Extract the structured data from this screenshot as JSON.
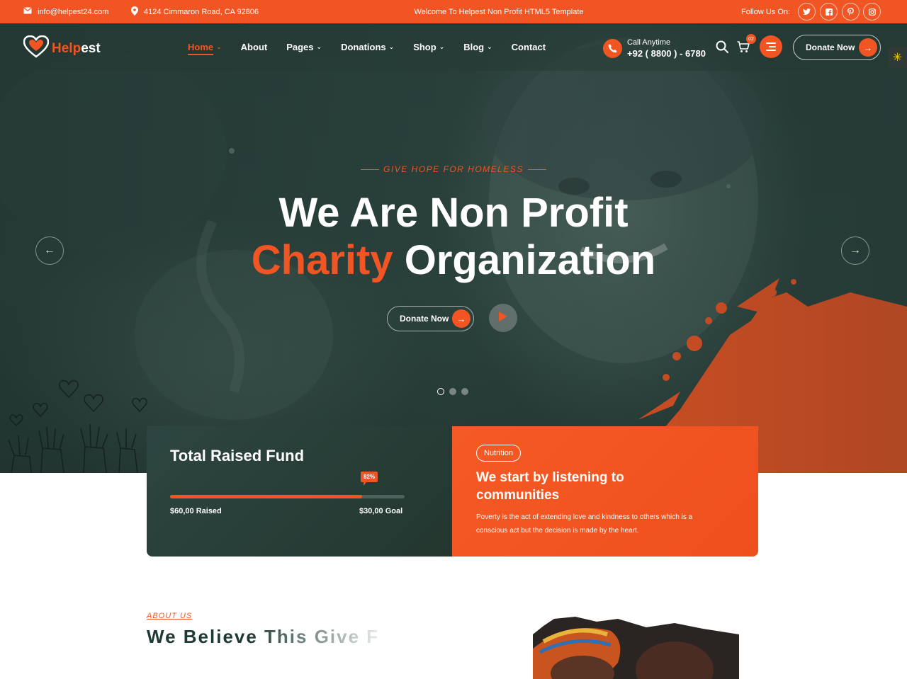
{
  "topbar": {
    "email": "info@helpest24.com",
    "address": "4124 Cimmaron Road, CA 92806",
    "welcome": "Welcome To Helpest Non Profit HTML5 Template",
    "follow_label": "Follow Us On:",
    "socials": [
      "twitter-icon",
      "facebook-icon",
      "pinterest-icon",
      "instagram-icon"
    ]
  },
  "brand": {
    "name_accent": "Help",
    "name_rest": "est"
  },
  "nav": {
    "items": [
      {
        "label": "Home",
        "active": true,
        "dropdown": true
      },
      {
        "label": "About",
        "active": false,
        "dropdown": false
      },
      {
        "label": "Pages",
        "active": false,
        "dropdown": true
      },
      {
        "label": "Donations",
        "active": false,
        "dropdown": true
      },
      {
        "label": "Shop",
        "active": false,
        "dropdown": true
      },
      {
        "label": "Blog",
        "active": false,
        "dropdown": true
      },
      {
        "label": "Contact",
        "active": false,
        "dropdown": false
      }
    ],
    "call_label": "Call Anytime",
    "phone": "+92 ( 8800 ) - 6780",
    "cart_count": "02",
    "donate_label": "Donate Now"
  },
  "hero": {
    "tagline": "GIVE HOPE FOR HOMELESS",
    "title_line1": "We Are Non Profit",
    "title_accent": "Charity",
    "title_rest": "Organization",
    "donate_label": "Donate Now",
    "slide_count": 3,
    "active_slide": 1
  },
  "fund_card": {
    "title": "Total Raised Fund",
    "percent_label": "82%",
    "percent": 82,
    "raised": "$60,00 Raised",
    "goal": "$30,00 Goal"
  },
  "story_card": {
    "badge": "Nutrition",
    "title": "We start by listening to communities",
    "text": "Poverty is the act of extending love and kindness to others which is a conscious act but the decision is made by the heart."
  },
  "about": {
    "eyebrow": "ABOUT US",
    "title": "We Believe This Give F"
  },
  "colors": {
    "accent": "#f05523",
    "dark": "#2c433e",
    "text_dark": "#1e3a36"
  }
}
